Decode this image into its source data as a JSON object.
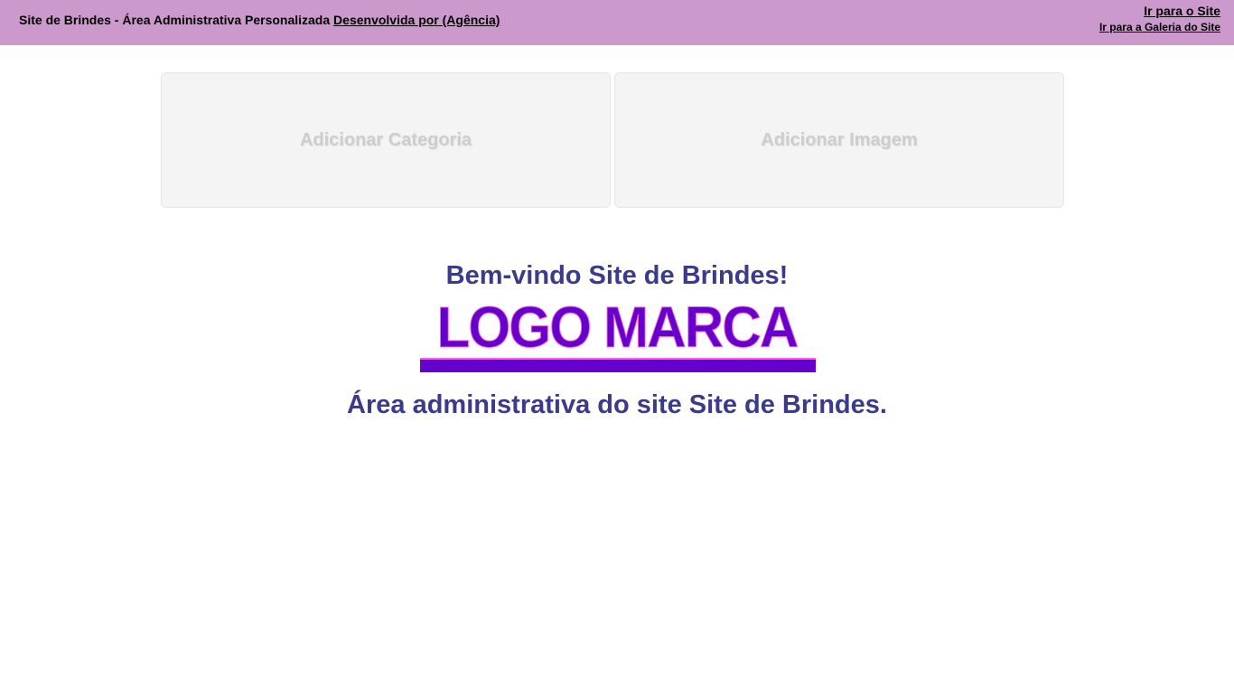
{
  "header": {
    "title": "Site de Brindes - Área Administrativa Personalizada",
    "credit_link": "Desenvolvida por (Agência)",
    "site_link": "Ir para o Site",
    "gallery_link": "Ir para a Galeria do Site"
  },
  "tiles": [
    {
      "label": "Adicionar Categoria"
    },
    {
      "label": "Adicionar Imagem"
    }
  ],
  "main": {
    "welcome": "Bem-vindo Site de Brindes!",
    "logo_text": "LOGO MARCA",
    "subtitle": "Área administrativa do site Site de Brindes."
  },
  "colors": {
    "header_bg": "#cc99cc",
    "heading_text": "#3b3b8c",
    "logo_fill": "#6600cc",
    "logo_outline": "#ff66cc",
    "tile_bg": "#f4f4f4",
    "tile_text": "#cdcdcd"
  }
}
